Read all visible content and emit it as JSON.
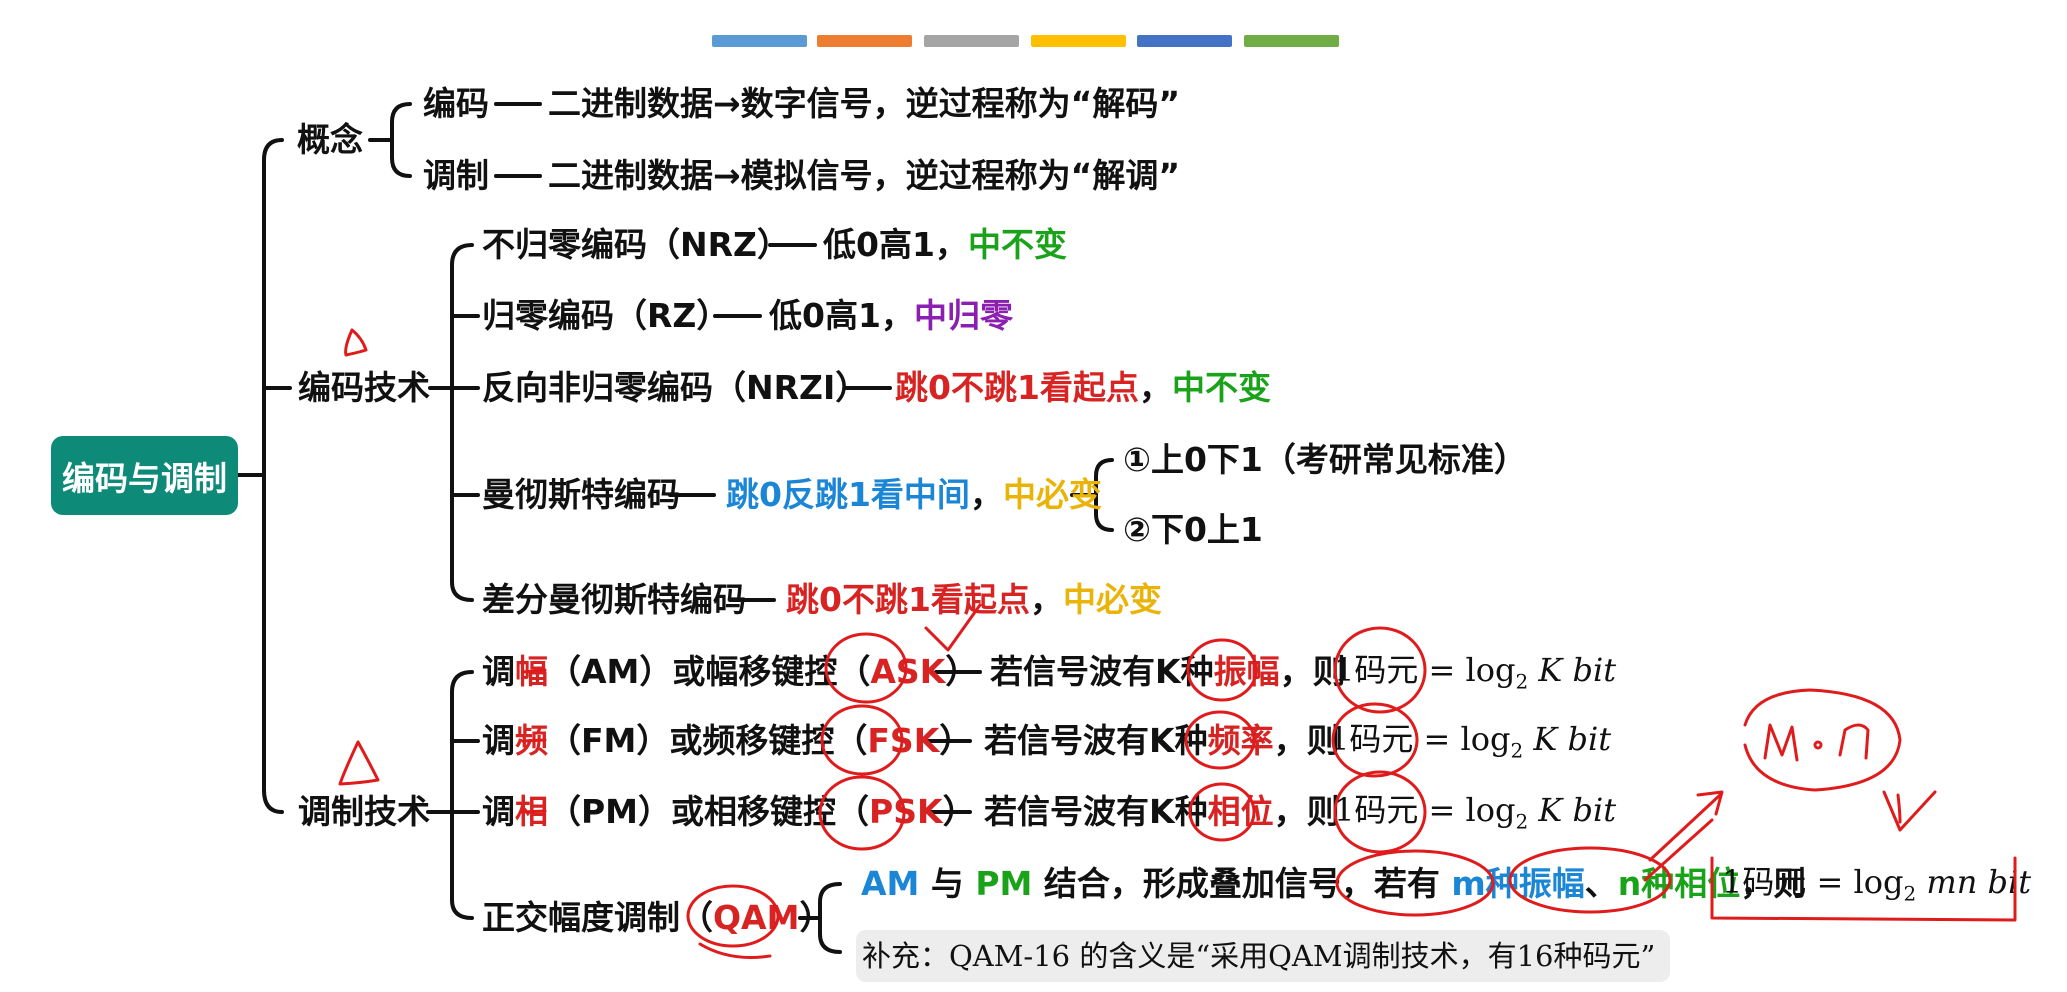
{
  "color_bar": [
    "#5b9bd5",
    "#ed7d31",
    "#a5a5a5",
    "#ffc000",
    "#4472c4",
    "#70ad47"
  ],
  "root": "编码与调制",
  "concept": {
    "label": "概念",
    "encode": {
      "label": "编码",
      "desc": "二进制数据→数字信号，逆过程称为“解码”"
    },
    "modulate": {
      "label": "调制",
      "desc": "二进制数据→模拟信号，逆过程称为“解调”"
    }
  },
  "encoding": {
    "label": "编码技术",
    "nrz": {
      "label": "不归零编码（NRZ）",
      "desc": "低0高1，",
      "note": "中不变"
    },
    "rz": {
      "label": "归零编码（RZ）",
      "desc": "低0高1，",
      "note": "中归零"
    },
    "nrzi": {
      "label": "反向非归零编码（NRZI）",
      "desc": "跳0不跳1看起点",
      "comma": "，",
      "note": "中不变"
    },
    "manchester": {
      "label": "曼彻斯特编码",
      "desc": "跳0反跳1看中间",
      "comma": "，",
      "note": "中必变",
      "opt1": "①上0下1（考研常见标准）",
      "opt2": "②下0上1"
    },
    "diff": {
      "label": "差分曼彻斯特编码",
      "desc": "跳0不跳1看起点",
      "comma": "，",
      "note": "中必变"
    }
  },
  "modulation": {
    "label": "调制技术",
    "am": {
      "pre": "调",
      "key": "幅",
      "post": "（AM）或幅移键控",
      "paren_l": "（",
      "abbr": "ASK",
      "paren_r": "）",
      "desc_a": "若信号波有K种",
      "desc_k": "振幅",
      "desc_b": "，则",
      "formula_a": "1码元",
      "formula_b": "= log",
      "formula_c": "2",
      "formula_d": "K bit"
    },
    "fm": {
      "pre": "调",
      "key": "频",
      "post": "（FM）或频移键控",
      "paren_l": "（",
      "abbr": "FSK",
      "paren_r": "）",
      "desc_a": "若信号波有K种",
      "desc_k": "频率",
      "desc_b": "，则",
      "formula_a": "1码元",
      "formula_b": "= log",
      "formula_c": "2",
      "formula_d": "K bit"
    },
    "pm": {
      "pre": "调",
      "key": "相",
      "post": "（PM）或相移键控",
      "paren_l": "（",
      "abbr": "PSK",
      "paren_r": "）",
      "desc_a": "若信号波有K种",
      "desc_k": "相位",
      "desc_b": "，则",
      "formula_a": "1码元",
      "formula_b": "= log",
      "formula_c": "2",
      "formula_d": "K bit"
    },
    "qam": {
      "label": "正交幅度调制（",
      "abbr": "QAM",
      "paren_r": "）",
      "line1": {
        "am": "AM",
        "and": " 与 ",
        "pm": "PM",
        "text": " 结合，形成叠加信号，若有 ",
        "m": "m种振幅",
        "sep": "、",
        "n": "n种相位",
        "then": "，则"
      },
      "formula_a": "1码元",
      "formula_b": "= log",
      "formula_c": "2",
      "formula_d": "mn bit",
      "note": "补充：QAM-16 的含义是“采用QAM调制技术，有16种码元”"
    }
  },
  "handwriting": {
    "mn": "m·n"
  }
}
